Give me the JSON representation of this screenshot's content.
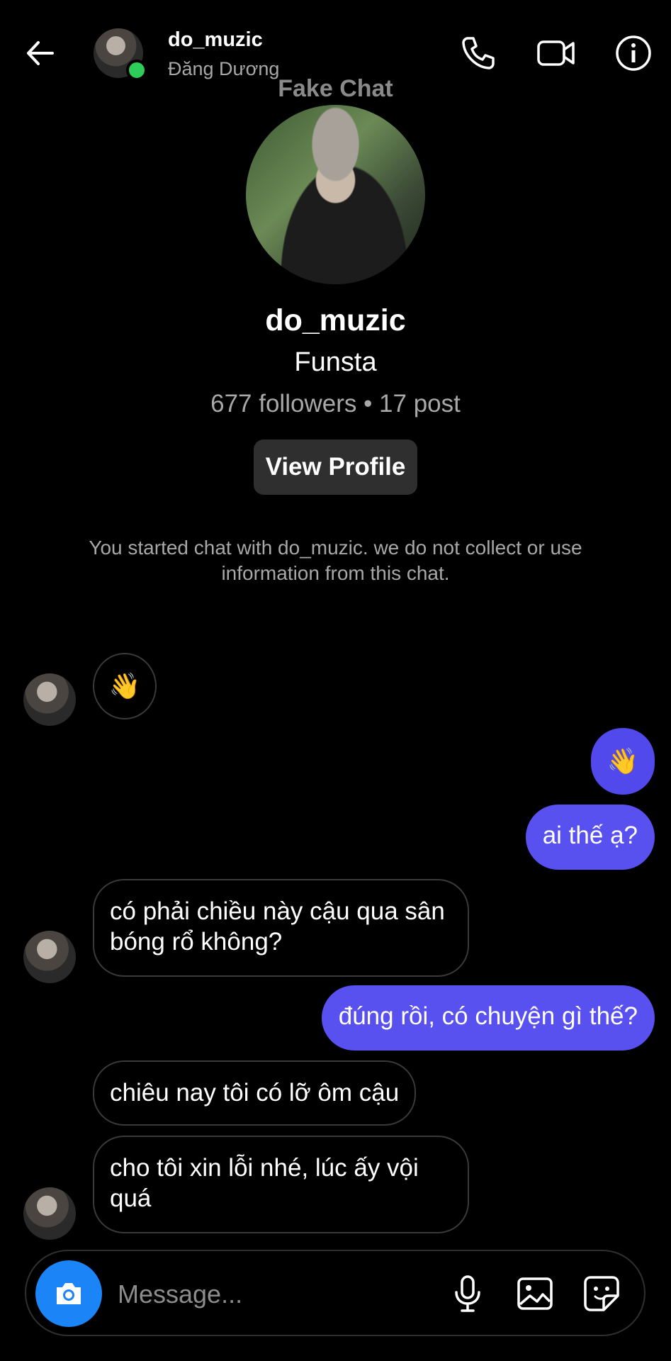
{
  "header": {
    "username": "do_muzic",
    "subtitle": "Đăng Dương",
    "watermark": "Fake Chat",
    "icons": [
      "back-arrow-icon",
      "phone-icon",
      "video-camera-icon",
      "info-icon"
    ]
  },
  "profile": {
    "name": "do_muzic",
    "type": "Funsta",
    "stats": "677 followers • 17 post",
    "view_button": "View Profile"
  },
  "notice": "You started chat with do_muzic. we do not collect or use information from this chat.",
  "messages": [
    {
      "from": "them",
      "text": "👋"
    },
    {
      "from": "me",
      "text": "👋"
    },
    {
      "from": "me",
      "text": "ai thế ạ?"
    },
    {
      "from": "them",
      "text": "có phải chiều này cậu qua sân bóng rổ không?"
    },
    {
      "from": "me",
      "text": "đúng rồi, có chuyện gì thế?"
    },
    {
      "from": "them",
      "text": "chiêu nay tôi có lỡ ôm cậu"
    },
    {
      "from": "them",
      "text": "cho tôi xin lỗi nhé, lúc ấy vội quá"
    }
  ],
  "composer": {
    "placeholder": "Message...",
    "icons": [
      "camera-icon",
      "microphone-icon",
      "image-icon",
      "sticker-icon"
    ]
  },
  "colors": {
    "background": "#000000",
    "outgoing_bubble": "#5851f0",
    "camera_button": "#1b84f6",
    "online_dot": "#2ecc59"
  }
}
